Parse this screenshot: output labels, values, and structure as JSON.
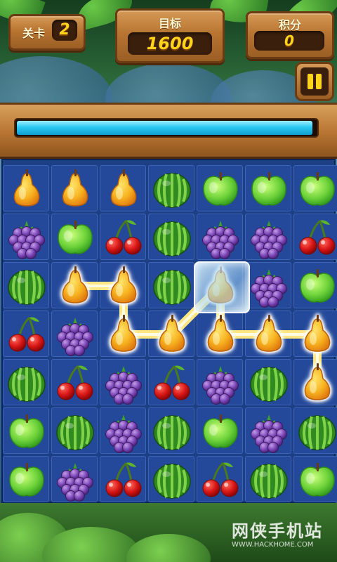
{
  "hud": {
    "level_label": "关卡",
    "level_value": "2",
    "target_label": "目标",
    "target_value": "1600",
    "score_label": "积分",
    "score_value": "0"
  },
  "progress": 0.98,
  "colors": {
    "board": "#1d3f86",
    "cell": "#24499b",
    "wood": "#b87532",
    "number": "#ffd21c",
    "progress": "#2bc9f2"
  },
  "board": {
    "rows": [
      [
        "pear",
        "pear",
        "pear",
        "watermelon",
        "apple",
        "apple",
        "apple"
      ],
      [
        "grape",
        "apple",
        "cherry",
        "watermelon",
        "grape",
        "grape",
        "cherry"
      ],
      [
        "watermelon",
        "pear",
        "pear",
        "watermelon",
        "pear",
        "grape",
        "apple"
      ],
      [
        "cherry",
        "grape",
        "pear",
        "pear",
        "pear",
        "pear",
        "pear"
      ],
      [
        "watermelon",
        "cherry",
        "grape",
        "cherry",
        "grape",
        "watermelon",
        "pear"
      ],
      [
        "apple",
        "watermelon",
        "grape",
        "watermelon",
        "apple",
        "grape",
        "watermelon"
      ],
      [
        "apple",
        "grape",
        "cherry",
        "watermelon",
        "cherry",
        "watermelon",
        "apple"
      ]
    ],
    "frozen": [
      [
        2,
        4
      ]
    ],
    "selected_path": [
      [
        2,
        1
      ],
      [
        2,
        2
      ],
      [
        3,
        2
      ],
      [
        3,
        3
      ],
      [
        2,
        4
      ],
      [
        3,
        4
      ],
      [
        3,
        5
      ],
      [
        3,
        6
      ],
      [
        4,
        6
      ]
    ]
  },
  "icons": {
    "pear": "pear-icon",
    "apple": "apple-icon",
    "grape": "grape-icon",
    "cherry": "cherry-icon",
    "watermelon": "watermelon-icon",
    "pause": "pause-icon"
  },
  "watermark": {
    "text": "网侠手机站",
    "url": "WWW.HACKHOME.COM"
  }
}
